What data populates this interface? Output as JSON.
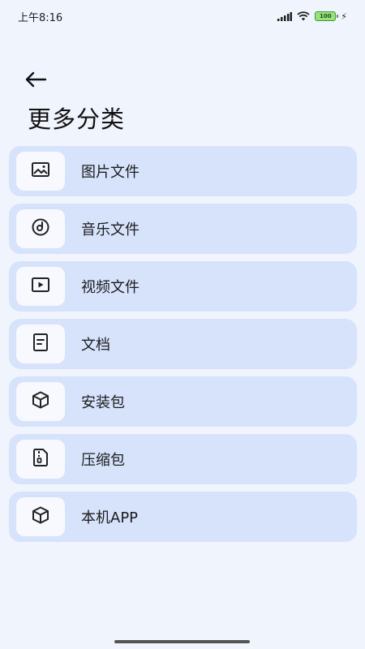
{
  "status_bar": {
    "time": "上午8:16",
    "battery_level": "100",
    "icons": [
      "signal-icon",
      "wifi-icon",
      "battery-icon",
      "charging-icon"
    ]
  },
  "header": {
    "back_icon": "arrow-left-icon",
    "title": "更多分类"
  },
  "categories": [
    {
      "label": "图片文件",
      "icon": "image-icon"
    },
    {
      "label": "音乐文件",
      "icon": "music-disc-icon"
    },
    {
      "label": "视频文件",
      "icon": "video-play-icon"
    },
    {
      "label": "文档",
      "icon": "document-icon"
    },
    {
      "label": "安装包",
      "icon": "package-cube-icon"
    },
    {
      "label": "压缩包",
      "icon": "zip-file-icon"
    },
    {
      "label": "本机APP",
      "icon": "app-cube-icon"
    }
  ],
  "colors": {
    "background": "#f0f4fd",
    "item_background": "#d6e3fb",
    "icon_box": "#f7f9fe",
    "battery": "#9be07a"
  }
}
